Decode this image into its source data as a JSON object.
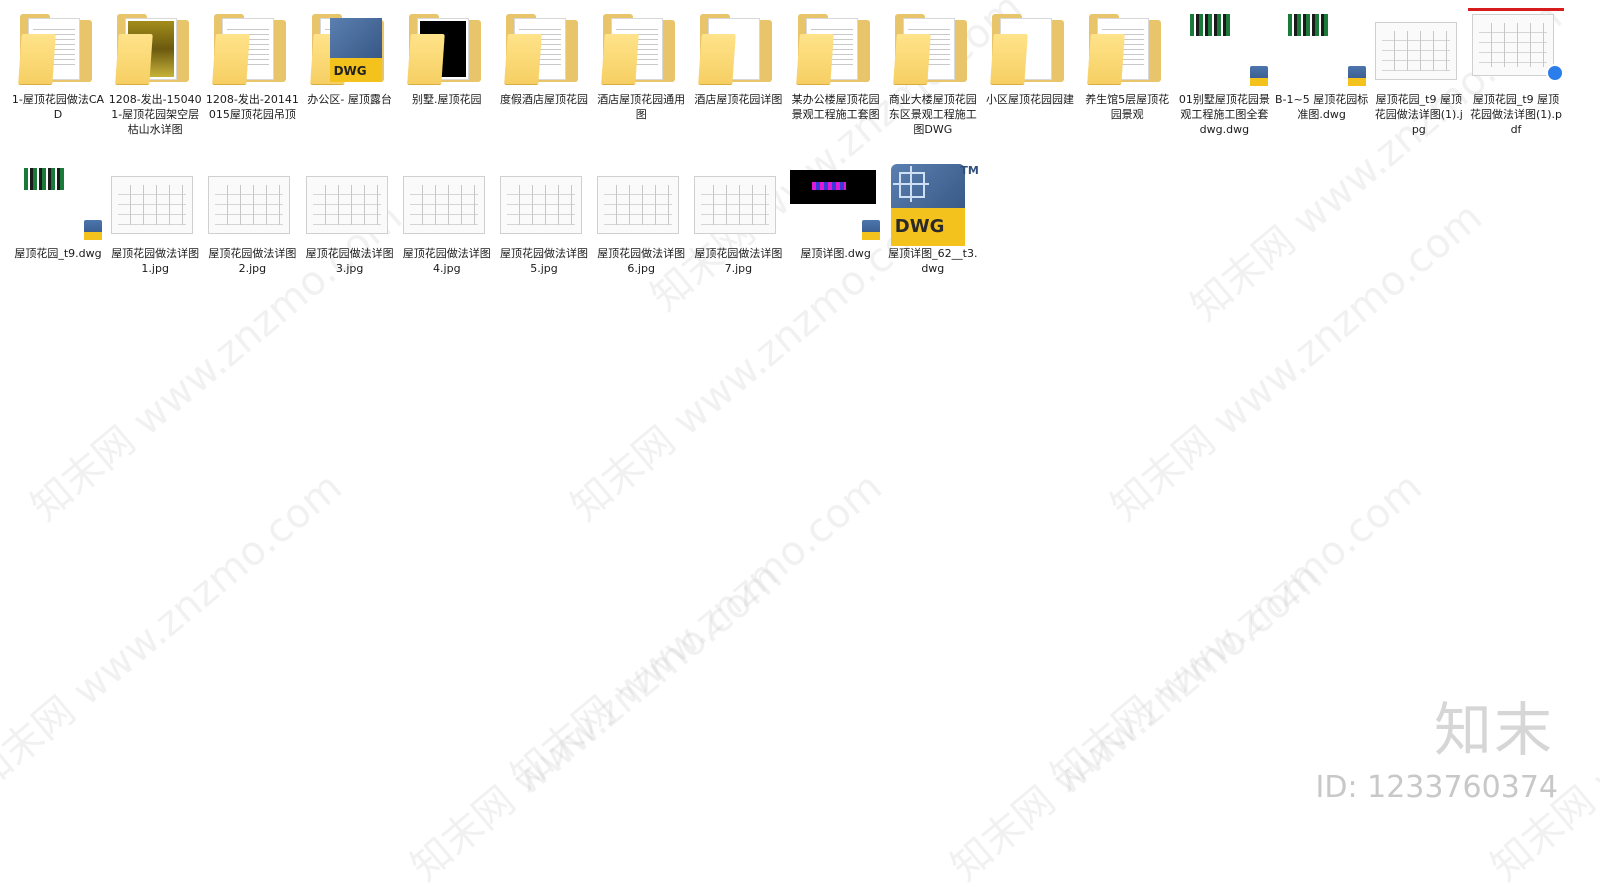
{
  "files_row1": [
    {
      "label": "1-屋顶花园做法CAD",
      "kind": "folder"
    },
    {
      "label": "1208-发出-150401-屋顶花园架空层枯山水详图",
      "kind": "folder"
    },
    {
      "label": "1208-发出-20141015屋顶花园吊顶",
      "kind": "folder"
    },
    {
      "label": "办公区- 屋顶露台",
      "kind": "folder-dwg"
    },
    {
      "label": "别墅.屋顶花园",
      "kind": "folder"
    },
    {
      "label": "度假酒店屋顶花园",
      "kind": "folder"
    },
    {
      "label": "酒店屋顶花园通用图",
      "kind": "folder"
    },
    {
      "label": "酒店屋顶花园详图",
      "kind": "folder"
    },
    {
      "label": "某办公楼屋顶花园景观工程施工套图",
      "kind": "folder"
    },
    {
      "label": "商业大楼屋顶花园东区景观工程施工图DWG",
      "kind": "folder"
    },
    {
      "label": "小区屋顶花园园建",
      "kind": "folder"
    },
    {
      "label": "养生馆5层屋顶花园景观",
      "kind": "folder"
    },
    {
      "label": "01别墅屋顶花园景观工程施工图全套dwg.dwg",
      "kind": "dwg-small"
    },
    {
      "label": "B-1~5 屋顶花园标准图.dwg",
      "kind": "dwg-small"
    },
    {
      "label": "屋顶花园_t9 屋顶花园做法详图(1).jpg",
      "kind": "image"
    },
    {
      "label": "屋顶花园_t9 屋顶花园做法详图(1).pdf",
      "kind": "pdf"
    }
  ],
  "files_row2": [
    {
      "label": "屋顶花园_t9.dwg",
      "kind": "dwg-small"
    },
    {
      "label": "屋顶花园做法详图1.jpg",
      "kind": "image"
    },
    {
      "label": "屋顶花园做法详图2.jpg",
      "kind": "image"
    },
    {
      "label": "屋顶花园做法详图3.jpg",
      "kind": "image"
    },
    {
      "label": "屋顶花园做法详图4.jpg",
      "kind": "image"
    },
    {
      "label": "屋顶花园做法详图5.jpg",
      "kind": "image"
    },
    {
      "label": "屋顶花园做法详图6.jpg",
      "kind": "image"
    },
    {
      "label": "屋顶花园做法详图7.jpg",
      "kind": "image"
    },
    {
      "label": "屋顶详图.dwg",
      "kind": "dwg-black"
    },
    {
      "label": "屋顶详图_62__t3.dwg",
      "kind": "dwg-big"
    }
  ],
  "dwg_icon": {
    "text": "DWG",
    "tm": "TM"
  },
  "watermark_text": "知末网 www.znzmo.com",
  "brand": "知末",
  "id_label": "ID: 1233760374"
}
